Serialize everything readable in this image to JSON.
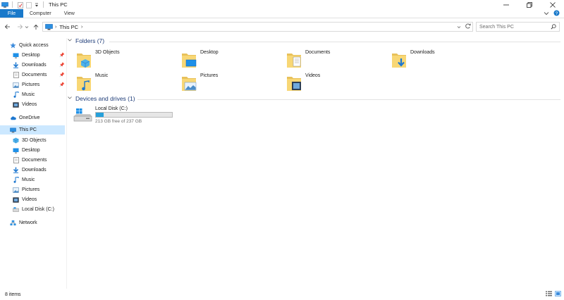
{
  "window": {
    "title": "This PC"
  },
  "ribbon": {
    "tabs": [
      "File",
      "Computer",
      "View"
    ]
  },
  "address": {
    "location": "This PC"
  },
  "search": {
    "placeholder": "Search This PC"
  },
  "nav": {
    "quick_access": "Quick access",
    "quick_items": [
      "Desktop",
      "Downloads",
      "Documents",
      "Pictures",
      "Music",
      "Videos"
    ],
    "onedrive": "OneDrive",
    "this_pc": "This PC",
    "pc_items": [
      "3D Objects",
      "Desktop",
      "Documents",
      "Downloads",
      "Music",
      "Pictures",
      "Videos",
      "Local Disk (C:)"
    ],
    "network": "Network"
  },
  "folders": {
    "header": "Folders (7)",
    "items": [
      {
        "label": "3D Objects",
        "icon": "3d-objects-folder-icon"
      },
      {
        "label": "Desktop",
        "icon": "desktop-folder-icon"
      },
      {
        "label": "Documents",
        "icon": "documents-folder-icon"
      },
      {
        "label": "Downloads",
        "icon": "downloads-folder-icon"
      },
      {
        "label": "Music",
        "icon": "music-folder-icon"
      },
      {
        "label": "Pictures",
        "icon": "pictures-folder-icon"
      },
      {
        "label": "Videos",
        "icon": "videos-folder-icon"
      }
    ]
  },
  "devices": {
    "header": "Devices and drives (1)",
    "drive_name": "Local Disk (C:)",
    "drive_free": "213 GB free of 237 GB",
    "used_fraction": 0.1
  },
  "status": {
    "items": "8 items"
  },
  "colors": {
    "accent": "#1979ca",
    "selected": "#cce8ff",
    "folder": "#f8d775",
    "group_header": "#1e3c78",
    "drive_bar": "#26a0da"
  }
}
